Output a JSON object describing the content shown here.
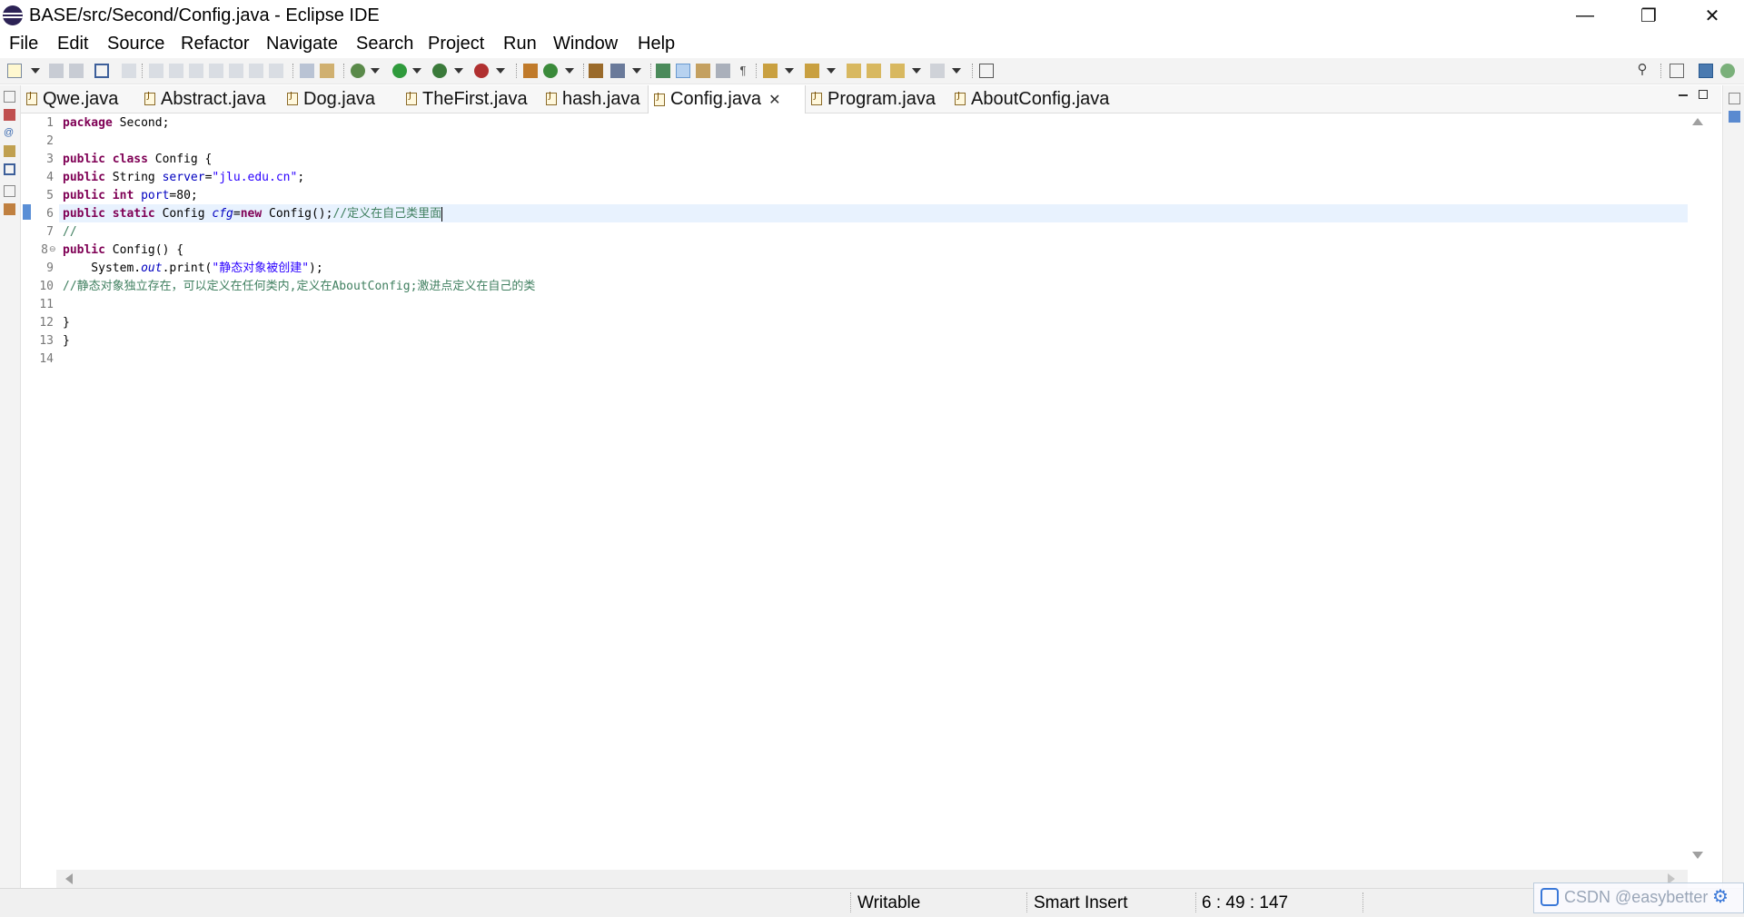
{
  "window": {
    "title": "BASE/src/Second/Config.java - Eclipse IDE",
    "minimize": "—",
    "maximize": "❐",
    "close": "✕"
  },
  "menu": [
    "File",
    "Edit",
    "Source",
    "Refactor",
    "Navigate",
    "Search",
    "Project",
    "Run",
    "Window",
    "Help"
  ],
  "tabs": [
    {
      "label": "Qwe.java",
      "active": false
    },
    {
      "label": "Abstract.java",
      "active": false
    },
    {
      "label": "Dog.java",
      "active": false
    },
    {
      "label": "TheFirst.java",
      "active": false
    },
    {
      "label": "hash.java",
      "active": false
    },
    {
      "label": "Config.java",
      "active": true,
      "close": "✕"
    },
    {
      "label": "Program.java",
      "active": false
    },
    {
      "label": "AboutConfig.java",
      "active": false
    }
  ],
  "editor": {
    "line_numbers": [
      "1",
      "2",
      "3",
      "4",
      "5",
      "6",
      "7",
      "8",
      "9",
      "10",
      "11",
      "12",
      "13",
      "14"
    ],
    "current_line": 6,
    "fold_marker": "⊖",
    "code": {
      "l1_kw": "package",
      "l1_rest": " Second;",
      "l3_kw": "public class",
      "l3_rest": " Config {",
      "l4_kw": "public",
      "l4_a": " String ",
      "l4_field": "server",
      "l4_eq": "=",
      "l4_str": "\"jlu.edu.cn\"",
      "l4_end": ";",
      "l5_kw": "public int",
      "l5_sp": " ",
      "l5_field": "port",
      "l5_rest": "=80;",
      "l6_kw": "public static",
      "l6_a": " Config ",
      "l6_field": "cfg",
      "l6_eq": "=",
      "l6_new": "new",
      "l6_b": " Config();",
      "l6_cmt": "//定义在自己类里面",
      "l7_cmt": "//",
      "l8_kw": "public",
      "l8_rest": " Config() {",
      "l9_a": "    System.",
      "l9_out": "out",
      "l9_b": ".print(",
      "l9_str": "\"静态对象被创建\"",
      "l9_end": ");",
      "l10_cmt": "//静态对象独立存在，可以定义在任何类内,定义在AboutConfig;激进点定义在自己的类",
      "l12": "}",
      "l13": "}"
    }
  },
  "status": {
    "writable": "Writable",
    "insert_mode": "Smart Insert",
    "position": "6 : 49 : 147"
  },
  "watermark": {
    "text": "CSDN @easybetter"
  },
  "colors": {
    "keyword": "#7f0055",
    "field": "#0000c0",
    "string": "#2a00ff",
    "comment": "#3f7f5f",
    "current_line": "#e8f2fe"
  }
}
